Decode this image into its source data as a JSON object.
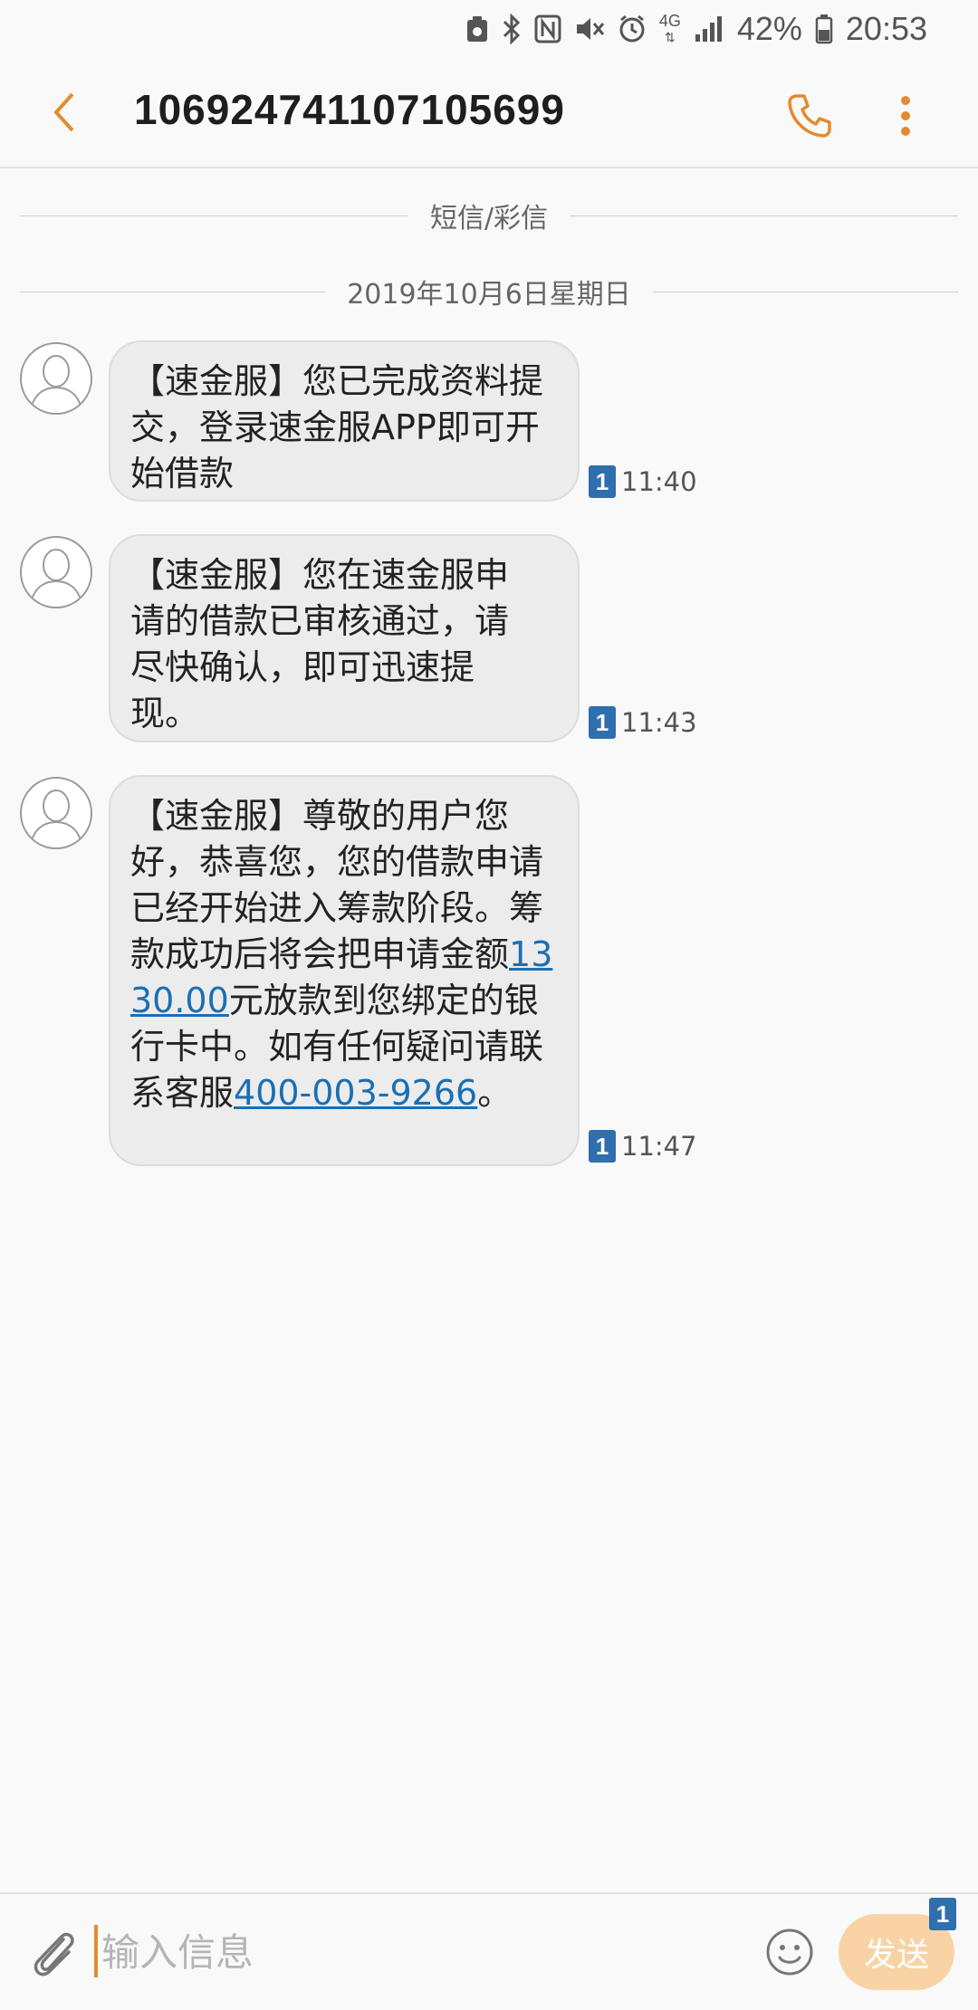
{
  "status_bar": {
    "battery": "42%",
    "time": "20:53",
    "network": "4G",
    "icons": [
      "screenshot-icon",
      "bluetooth-icon",
      "nfc-icon",
      "mute-icon",
      "alarm-icon",
      "network-4g-icon",
      "signal-icon",
      "battery-icon"
    ]
  },
  "header": {
    "title": "106924741107105699",
    "back_icon": "chevron-left-icon",
    "call_icon": "phone-icon",
    "more_icon": "more-vertical-icon",
    "accent_color": "#e48a2f"
  },
  "conversation": {
    "type_label": "短信/彩信",
    "date_label": "2019年10月6日星期日",
    "messages": [
      {
        "text": "【速金服】您已完成资料提交，登录速金服APP即可开始借款",
        "sim": "1",
        "time": "11:40"
      },
      {
        "text": "【速金服】您在速金服申请的借款已审核通过，请尽快确认，即可迅速提现。",
        "sim": "1",
        "time": "11:43"
      },
      {
        "text_before_amount": "【速金服】尊敬的用户您好，恭喜您，您的借款申请已经开始进入筹款阶段。筹款成功后将会把申请金额",
        "amount_link": "1330.00",
        "text_after_amount": "元放款到您绑定的银行卡中。如有任何疑问请联系客服",
        "phone_link": "400-003-9266",
        "text_end": "。",
        "sim": "1",
        "time": "11:47"
      }
    ]
  },
  "composer": {
    "placeholder": "输入信息",
    "send_label": "发送",
    "send_sim": "1",
    "send_color": "#f7d3a6",
    "link_color": "#1b6fb3"
  }
}
